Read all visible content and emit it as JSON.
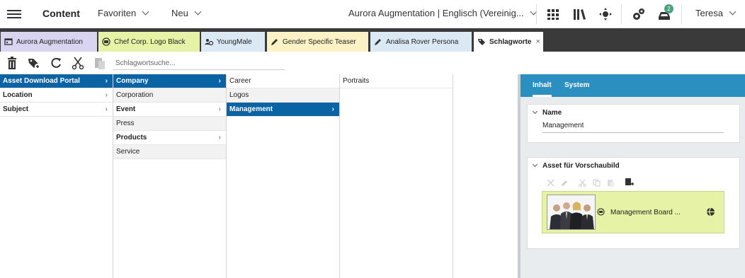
{
  "header": {
    "app_title": "Content",
    "favorites_label": "Favoriten",
    "new_label": "Neu",
    "site_label": "Aurora Augmentation | Englisch (Vereinig...",
    "notification_count": "2",
    "user_name": "Teresa"
  },
  "tabs": [
    {
      "label": "Aurora Augmentation",
      "icon": "site-icon",
      "color": "#d9d4f0"
    },
    {
      "label": "Chef Corp. Logo Black",
      "icon": "picture-icon",
      "color": "#e6f2a5"
    },
    {
      "label": "YoungMale",
      "icon": "persona-icon",
      "color": "#dbe9f5"
    },
    {
      "label": "Gender Specific Teaser",
      "icon": "pencil-icon",
      "color": "#fbf3c5"
    },
    {
      "label": "Analisa Rover Persona",
      "icon": "pencil-icon",
      "color": "#dbe9f5"
    },
    {
      "label": "Schlagworte",
      "icon": "tags-icon",
      "color": "#ffffff",
      "close": "×"
    }
  ],
  "toolbar": {
    "search_placeholder": "Schlagwortsuche..."
  },
  "columns": {
    "col1": [
      {
        "label": "Asset Download Portal",
        "state": "selected",
        "has_children": true
      },
      {
        "label": "Location",
        "state": "bold",
        "has_children": true
      },
      {
        "label": "Subject",
        "state": "bold",
        "has_children": true
      }
    ],
    "col2": [
      {
        "label": "Company",
        "state": "selected",
        "has_children": true
      },
      {
        "label": "Corporation",
        "state": "normal",
        "has_children": false
      },
      {
        "label": "Event",
        "state": "bold",
        "has_children": true
      },
      {
        "label": "Press",
        "state": "normal",
        "has_children": false
      },
      {
        "label": "Products",
        "state": "bold",
        "has_children": true
      },
      {
        "label": "Service",
        "state": "normal",
        "has_children": false
      }
    ],
    "col3": [
      {
        "label": "Career",
        "state": "normal",
        "has_children": false
      },
      {
        "label": "Logos",
        "state": "normal",
        "has_children": false
      },
      {
        "label": "Management",
        "state": "selected",
        "has_children": true
      }
    ],
    "col4": [
      {
        "label": "Portraits",
        "state": "normal",
        "has_children": false
      }
    ],
    "arrow": "›"
  },
  "panel": {
    "tab_content": "Inhalt",
    "tab_system": "System",
    "name_section_title": "Name",
    "name_value": "Management",
    "asset_section_title": "Asset für Vorschaubild",
    "asset_label": "Management Board ..."
  },
  "colors": {
    "selected": "#0a64a4",
    "panel_header": "#2b8fc0",
    "asset_bg": "#e6f2a5",
    "badge": "#4ca07d",
    "tab_strip": "#3a3a3a"
  }
}
